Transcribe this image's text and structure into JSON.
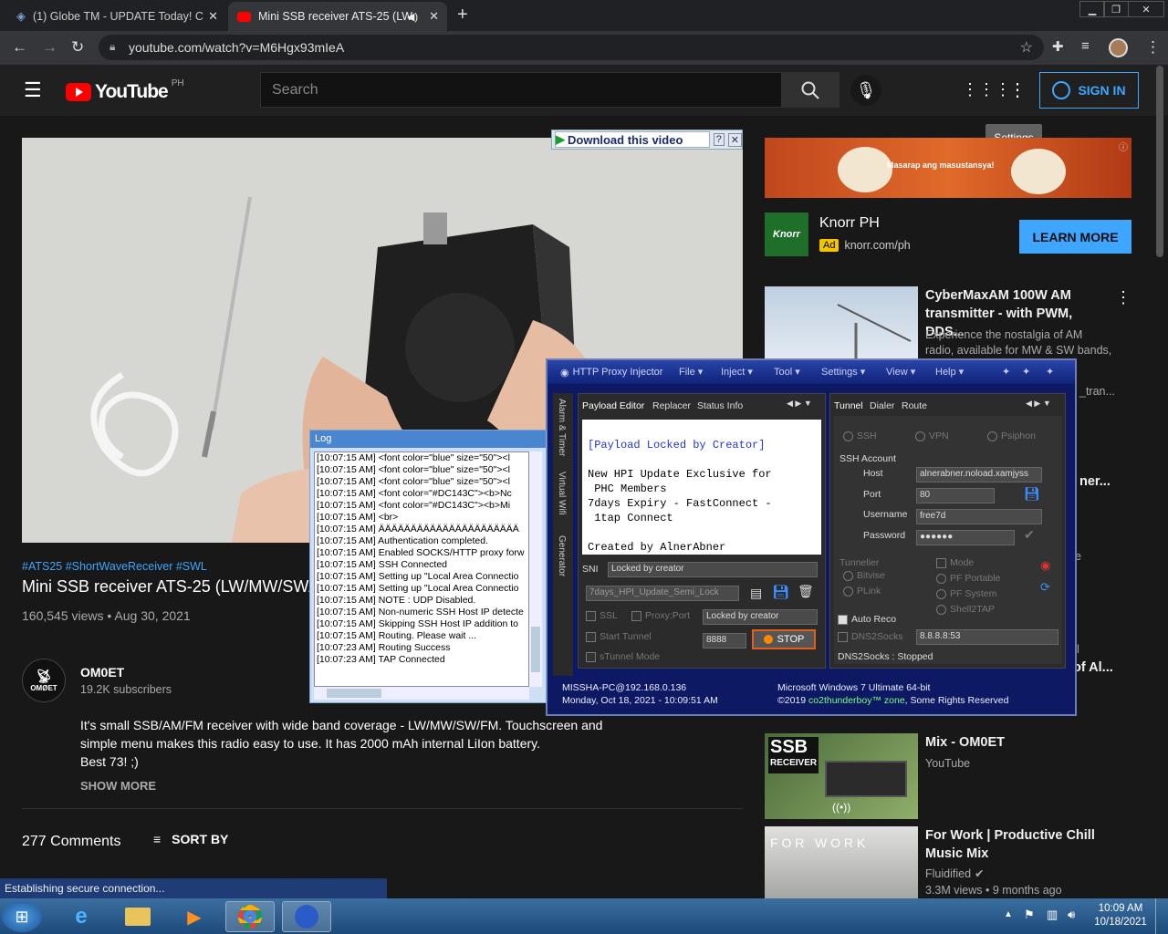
{
  "browser": {
    "tabs": [
      {
        "label": "(1) Globe TM - UPDATE Today! C",
        "close": "✕"
      },
      {
        "label": "Mini SSB receiver ATS-25 (LW",
        "close": "✕"
      }
    ],
    "new_tab": "+",
    "url": "youtube.com/watch?v=M6Hgx93mIeA",
    "window_controls": [
      "▁",
      "❐",
      "✕"
    ]
  },
  "youtube": {
    "logo": "YouTube",
    "region": "PH",
    "search_placeholder": "Search",
    "signin": "SIGN IN",
    "tooltip": "Settings",
    "download_bar": "Download this video",
    "video": {
      "hashtags": "#ATS25 #ShortWaveReceiver #SWL",
      "title": "Mini SSB receiver ATS-25 (LW/MW/SW/",
      "views": "160,545 views • Aug 30, 2021"
    },
    "channel": {
      "name": "OM0ET",
      "subs": "19.2K subscribers",
      "avatar_text": "OMØET"
    },
    "description": [
      "It's small SSB/AM/FM receiver with wide band coverage - LW/MW/SW/FM. Touchscreen and",
      "simple menu makes this radio easy to use. It has 2000 mAh internal LiIon battery.",
      "Best 73! ;)"
    ],
    "show_more": "SHOW MORE",
    "comments": "277 Comments",
    "sort_by": "SORT BY",
    "ad": {
      "banner_text": "Masarap ang masustansya!",
      "name": "Knorr PH",
      "badge": "Ad",
      "url": "knorr.com/ph",
      "cta": "LEARN MORE"
    },
    "recs": [
      {
        "title1": "CyberMaxAM 100W AM",
        "title2": "transmitter - with PWM, DDS...",
        "desc1": "Experience the nostalgia of AM",
        "desc2": "radio, available for MW & SW bands,"
      },
      {
        "title1": "Mix - OM0ET",
        "title2": "",
        "channel": "YouTube",
        "thumb_text1": "SSB",
        "thumb_text2": "RECEIVER"
      },
      {
        "title1": "For Work | Productive Chill",
        "title2": "Music Mix",
        "channel": "Fluidified",
        "meta": "3.3M views • 9 months ago",
        "thumb_text": "F O R   W O R K"
      }
    ],
    "partial_texts": {
      "a": "_tran...",
      "b": "ner...",
      "c": "e",
      "d": "l",
      "e": "of Al..."
    }
  },
  "hpi": {
    "title": "HTTP Proxy Injector",
    "menus": [
      "File ▾",
      "Inject ▾",
      "Tool ▾",
      "Settings ▾",
      "View ▾",
      "Help ▾"
    ],
    "side_tabs": [
      "Alarm & Timer",
      "Virtual Wifi",
      "Generator"
    ],
    "left_tabs": [
      "Payload Editor",
      "Replacer",
      "Status Info"
    ],
    "right_tabs": [
      "Tunnel",
      "Dialer",
      "Route"
    ],
    "payload_lines": [
      "[Payload Locked by Creator]",
      "",
      "New HPI Update Exclusive for",
      " PHC Members",
      "7days Expiry - FastConnect -",
      " 1tap Connect",
      "",
      "Created by AlnerAbner"
    ],
    "sni_label": "SNI",
    "sni_value": "Locked by creator",
    "profile": "7days_HPI_Update_Semi_Lock",
    "ssl": "SSL",
    "proxy_port": "Proxy:Port",
    "proxy_value": "Locked by creator",
    "start_tunnel": "Start Tunnel",
    "port_value": "8888",
    "stop": "STOP",
    "stunnel": "sTunnel Mode",
    "modes": [
      "SSH",
      "VPN",
      "Psiphon"
    ],
    "ssh_account": "SSH Account",
    "host_label": "Host",
    "host": "alnerabner.noload.xamjyss",
    "port_label": "Port",
    "port": "80",
    "user_label": "Username",
    "user": "free7d",
    "pass_label": "Password",
    "pass": "●●●●●●",
    "tunneller": "Tunnelier",
    "bitvise": "Bitvise",
    "plink": "PLink",
    "mode": "Mode",
    "pf_portable": "PF Portable",
    "pf_system": "PF System",
    "shell2tap": "Shell2TAP",
    "auto_reco": "Auto Reco",
    "dns2socks": "DNS2Socks",
    "dns": "8.8.8.8:53",
    "dns_status": "DNS2Socks : Stopped",
    "footer_l1": "MISSHA-PC@192.168.0.136",
    "footer_l2": "Monday, Oct 18, 2021 - 10:09:51 AM",
    "footer_r1": "Microsoft Windows 7 Ultimate  64-bit",
    "footer_r2a": "©2019 ",
    "footer_r2b": "co2thunderboy™ zone",
    "footer_r2c": ", Some Rights Reserved"
  },
  "log": {
    "title": "Log",
    "lines": [
      "[10:07:15 AM] <font color=\"blue\" size=\"50\"><l",
      "[10:07:15 AM] <font color=\"blue\" size=\"50\"><l",
      "[10:07:15 AM] <font color=\"blue\" size=\"50\"><l",
      "[10:07:15 AM] <font color=\"#DC143C\"><b>Nc",
      "[10:07:15 AM] <font color=\"#DC143C\"><b>Mi",
      "[10:07:15 AM] <br>",
      "[10:07:15 AM] ÄÄÄÄÄÄÄÄÄÄÄÄÄÄÄÄÄÄÄÄÄÄ",
      "[10:07:15 AM] Authentication completed.",
      "[10:07:15 AM] Enabled SOCKS/HTTP proxy forw",
      "[10:07:15 AM] SSH Connected",
      "[10:07:15 AM] Setting up \"Local Area Connectio",
      "[10:07:15 AM] Setting up \"Local Area Connectio",
      "[10:07:15 AM] NOTE : UDP Disabled.",
      "[10:07:15 AM] Non-numeric SSH Host IP detecte",
      "[10:07:15 AM] Skipping SSH Host IP addition to",
      "[10:07:15 AM] Routing. Please wait ...",
      "[10:07:23 AM] Routing Success",
      "[10:07:23 AM] TAP Connected"
    ]
  },
  "status_bar": "Establishing secure connection...",
  "taskbar": {
    "time": "10:09 AM",
    "date": "10/18/2021"
  },
  "colors": {
    "yt_bg": "#181818",
    "accent_blue": "#3ea6ff",
    "hpi_bg": "#0d1a63",
    "learn_more": "#3ea6ff"
  }
}
